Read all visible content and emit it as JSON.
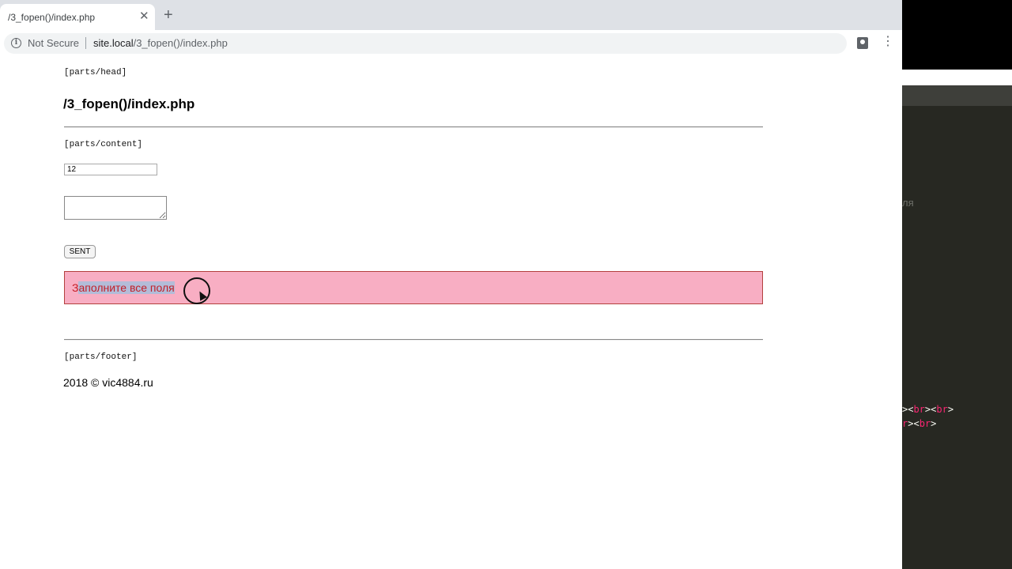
{
  "browser": {
    "tab_title": "/3_fopen()/index.php",
    "tab_close_glyph": "✕",
    "new_tab_glyph": "+",
    "security_label": "Not Secure",
    "url_host": "site.local",
    "url_path": "/3_fopen()/index.php",
    "menu_glyph": "⋮"
  },
  "page": {
    "head_marker": "[parts/head]",
    "title": "/3_fopen()/index.php",
    "content_marker": "[parts/content]",
    "input_value": "12",
    "textarea_value": "",
    "submit_label": "SENT",
    "alert_first_char": "З",
    "alert_selected": "аполните все поля",
    "alert_color": "#f8aec3",
    "footer_marker": "[parts/footer]",
    "footer_text": "2018 © vic4884.ru"
  },
  "editor": {
    "ghost_text": "ля",
    "line1_pre": "><",
    "line1_tag1": "br",
    "line1_mid": "><",
    "line1_tag2": "br",
    "line1_post": ">",
    "line2_tag": "r",
    "line2_mid": "><",
    "line2_tag2": "br",
    "line2_post": ">"
  }
}
